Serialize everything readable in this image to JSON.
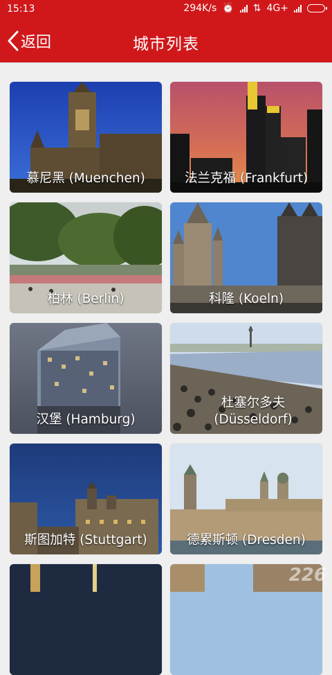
{
  "status": {
    "time": "15:13",
    "speed": "294K/s",
    "network": "4G+"
  },
  "nav": {
    "back_label": "返回",
    "title": "城市列表"
  },
  "cities": [
    {
      "label": "慕尼黑 (Muenchen)"
    },
    {
      "label": "法兰克福 (Frankfurt)"
    },
    {
      "label": "柏林 (Berlin)"
    },
    {
      "label": "科隆 (Koeln)"
    },
    {
      "label": "汉堡 (Hamburg)"
    },
    {
      "label": "杜塞尔多夫 (Düsseldorf)"
    },
    {
      "label": "斯图加特 (Stuttgart)"
    },
    {
      "label": "德累斯顿 (Dresden)"
    }
  ],
  "watermark": "226"
}
